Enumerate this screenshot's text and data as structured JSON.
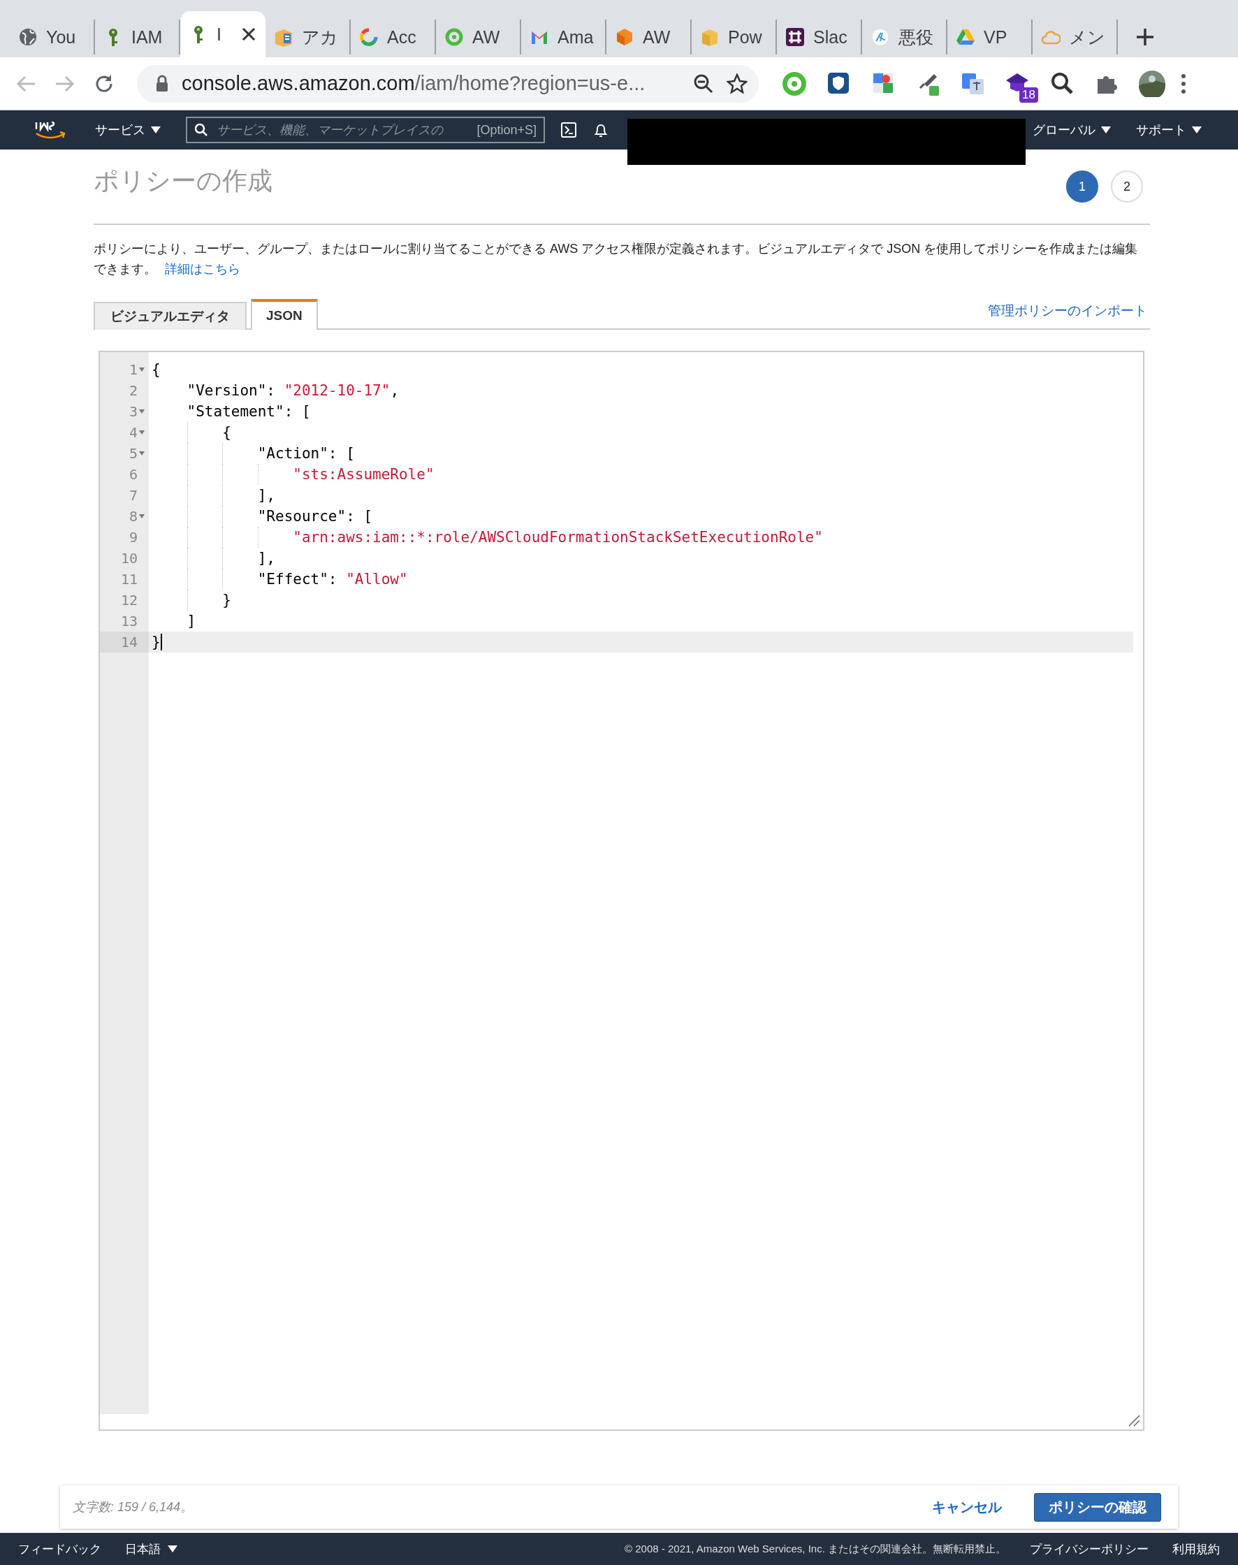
{
  "browser": {
    "tabs": [
      {
        "title": "You",
        "kind": "globe",
        "selected": false
      },
      {
        "title": "IAM",
        "kind": "key",
        "selected": false
      },
      {
        "title": "I",
        "kind": "key",
        "selected": true
      },
      {
        "title": "アカ",
        "kind": "book",
        "selected": false
      },
      {
        "title": "Acc",
        "kind": "gring",
        "selected": false
      },
      {
        "title": "AW",
        "kind": "ring",
        "selected": false
      },
      {
        "title": "Ama",
        "kind": "mail",
        "selected": false
      },
      {
        "title": "AW",
        "kind": "cube",
        "selected": false
      },
      {
        "title": "Pow",
        "kind": "box",
        "selected": false
      },
      {
        "title": "Slac",
        "kind": "slack",
        "selected": false
      },
      {
        "title": "悪役",
        "kind": "script",
        "selected": false
      },
      {
        "title": "VP",
        "kind": "drive",
        "selected": false
      },
      {
        "title": "メン",
        "kind": "cloud",
        "selected": false
      }
    ],
    "address": {
      "host": "console.aws.amazon.com",
      "path": "/iam/home?region=us-e..."
    },
    "extensions": [
      {
        "kind": "ring"
      },
      {
        "kind": "shield"
      },
      {
        "kind": "map"
      },
      {
        "kind": "dropper"
      },
      {
        "kind": "translate"
      },
      {
        "kind": "cap",
        "badge": "18"
      },
      {
        "kind": "magnifier"
      },
      {
        "kind": "puzzle"
      },
      {
        "kind": "avatar"
      }
    ]
  },
  "nav": {
    "services": "サービス",
    "search_placeholder": "サービス、機能、マーケットプレイスの",
    "shortcut": "[Option+S]",
    "region": "グローバル",
    "support": "サポート"
  },
  "page": {
    "title": "ポリシーの作成",
    "steps": [
      {
        "label": "1",
        "selected": true
      },
      {
        "label": "2",
        "selected": false
      }
    ],
    "description": "ポリシーにより、ユーザー、グループ、またはロールに割り当てることができる AWS アクセス権限が定義されます。ビジュアルエディタで JSON を使用してポリシーを作成または編集できます。",
    "learn_more": "詳細はこちら",
    "tabs": [
      {
        "label": "ビジュアルエディタ",
        "selected": false
      },
      {
        "label": "JSON",
        "selected": true
      }
    ],
    "import_link": "管理ポリシーのインポート",
    "editor": {
      "lines": [
        {
          "number": "1",
          "foldable": true,
          "active": false,
          "tokens": [
            {
              "kind": "punct",
              "text": "{"
            }
          ]
        },
        {
          "number": "2",
          "foldable": false,
          "active": false,
          "tokens": [
            {
              "kind": "punct",
              "text": "    \"Version\": "
            },
            {
              "kind": "string",
              "text": "\"2012-10-17\""
            },
            {
              "kind": "punct",
              "text": ","
            }
          ]
        },
        {
          "number": "3",
          "foldable": true,
          "active": false,
          "tokens": [
            {
              "kind": "punct",
              "text": "    \"Statement\": ["
            }
          ]
        },
        {
          "number": "4",
          "foldable": true,
          "active": false,
          "tokens": [
            {
              "kind": "punct",
              "text": "        {"
            }
          ]
        },
        {
          "number": "5",
          "foldable": true,
          "active": false,
          "tokens": [
            {
              "kind": "punct",
              "text": "            \"Action\": ["
            }
          ]
        },
        {
          "number": "6",
          "foldable": false,
          "active": false,
          "tokens": [
            {
              "kind": "string",
              "text": "                \"sts:AssumeRole\""
            }
          ]
        },
        {
          "number": "7",
          "foldable": false,
          "active": false,
          "tokens": [
            {
              "kind": "punct",
              "text": "            ],"
            }
          ]
        },
        {
          "number": "8",
          "foldable": true,
          "active": false,
          "tokens": [
            {
              "kind": "punct",
              "text": "            \"Resource\": ["
            }
          ]
        },
        {
          "number": "9",
          "foldable": false,
          "active": false,
          "tokens": [
            {
              "kind": "string",
              "text": "                \"arn:aws:iam::*:role/AWSCloudFormationStackSetExecutionRole\""
            }
          ]
        },
        {
          "number": "10",
          "foldable": false,
          "active": false,
          "tokens": [
            {
              "kind": "punct",
              "text": "            ],"
            }
          ]
        },
        {
          "number": "11",
          "foldable": false,
          "active": false,
          "tokens": [
            {
              "kind": "punct",
              "text": "            \"Effect\": "
            },
            {
              "kind": "string",
              "text": "\"Allow\""
            }
          ]
        },
        {
          "number": "12",
          "foldable": false,
          "active": false,
          "tokens": [
            {
              "kind": "punct",
              "text": "        }"
            }
          ]
        },
        {
          "number": "13",
          "foldable": false,
          "active": false,
          "tokens": [
            {
              "kind": "punct",
              "text": "    ]"
            }
          ]
        },
        {
          "number": "14",
          "foldable": false,
          "active": true,
          "tokens": [
            {
              "kind": "punct",
              "text": "}"
            }
          ]
        }
      ]
    },
    "char_count": "文字数: 159 / 6,144。",
    "cancel": "キャンセル",
    "confirm": "ポリシーの確認"
  },
  "footer": {
    "feedback": "フィードバック",
    "language": "日本語",
    "copyright": "© 2008 - 2021, Amazon Web Services, Inc. またはその関連会社。無断転用禁止。",
    "privacy": "プライバシーポリシー",
    "terms": "利用規約"
  }
}
